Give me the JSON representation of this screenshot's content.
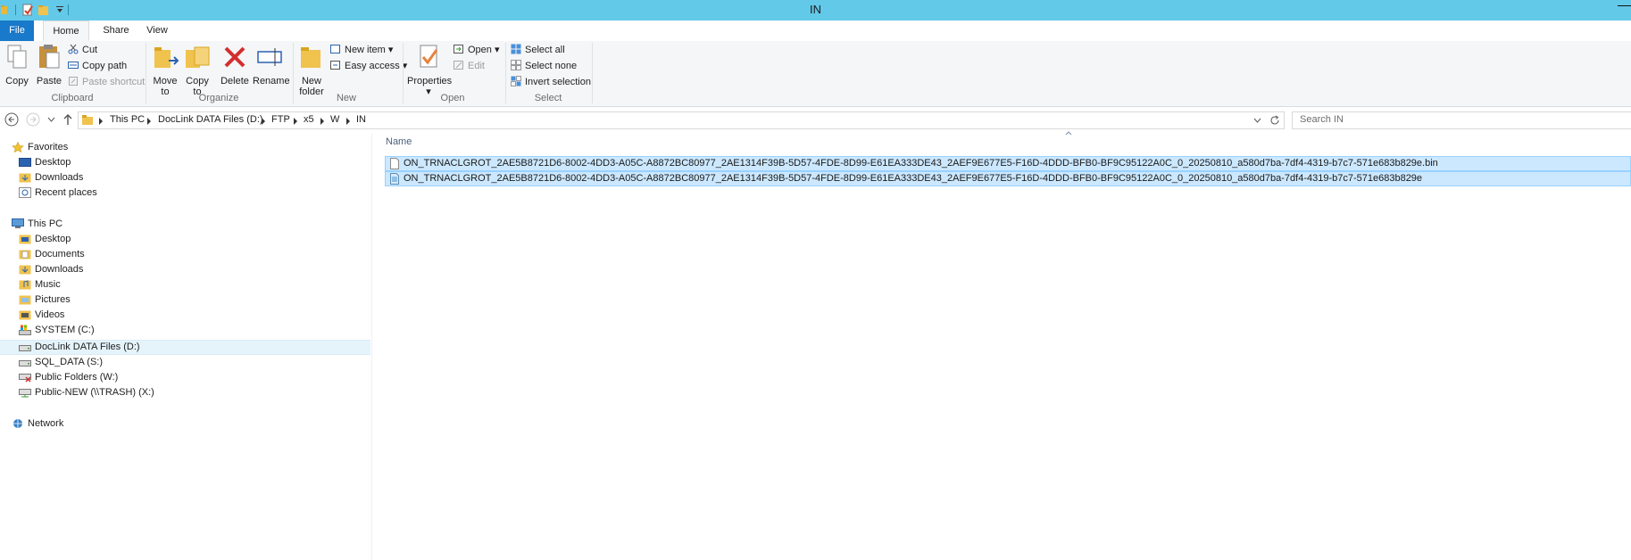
{
  "window": {
    "title": "IN"
  },
  "menu_tabs": {
    "file": "File",
    "home": "Home",
    "share": "Share",
    "view": "View"
  },
  "ribbon": {
    "clipboard": {
      "label": "Clipboard",
      "copy": "Copy",
      "paste": "Paste",
      "cut": "Cut",
      "copy_path": "Copy path",
      "paste_shortcut": "Paste shortcut"
    },
    "organize": {
      "label": "Organize",
      "move_to_1": "Move",
      "move_to_2": "to",
      "copy_to_1": "Copy",
      "copy_to_2": "to",
      "delete": "Delete",
      "rename": "Rename"
    },
    "new": {
      "label": "New",
      "new_folder_1": "New",
      "new_folder_2": "folder",
      "new_item": "New item",
      "easy_access": "Easy access"
    },
    "open": {
      "label": "Open",
      "properties": "Properties",
      "open": "Open",
      "edit": "Edit"
    },
    "select": {
      "label": "Select",
      "select_all": "Select all",
      "select_none": "Select none",
      "invert_selection": "Invert selection"
    }
  },
  "address": {
    "crumbs": [
      "This PC",
      "DocLink DATA Files (D:)",
      "FTP",
      "x5",
      "W",
      "IN"
    ],
    "search_placeholder": "Search IN"
  },
  "nav": {
    "favorites": "Favorites",
    "fav_items": [
      "Desktop",
      "Downloads",
      "Recent places"
    ],
    "this_pc": "This PC",
    "pc_items": [
      "Desktop",
      "Documents",
      "Downloads",
      "Music",
      "Pictures",
      "Videos",
      "SYSTEM (C:)",
      "DocLink DATA Files (D:)",
      "SQL_DATA (S:)",
      "Public Folders (W:)",
      "Public-NEW (\\\\TRASH) (X:)"
    ],
    "network": "Network"
  },
  "files": {
    "column_name": "Name",
    "rows": [
      "ON_TRNACLGROT_2AE5B8721D6-8002-4DD3-A05C-A8872BC80977_2AE1314F39B-5D57-4FDE-8D99-E61EA333DE43_2AEF9E677E5-F16D-4DDD-BFB0-BF9C95122A0C_0_20250810_a580d7ba-7df4-4319-b7c7-571e683b829e.bin",
      "ON_TRNACLGROT_2AE5B8721D6-8002-4DD3-A05C-A8872BC80977_2AE1314F39B-5D57-4FDE-8D99-E61EA333DE43_2AEF9E677E5-F16D-4DDD-BFB0-BF9C95122A0C_0_20250810_a580d7ba-7df4-4319-b7c7-571e683b829e"
    ]
  },
  "colors": {
    "titlebar": "#63c9e9",
    "file_tab": "#1979ca",
    "selection": "#cce8ff",
    "nav_selected": "#e5f3fb"
  }
}
